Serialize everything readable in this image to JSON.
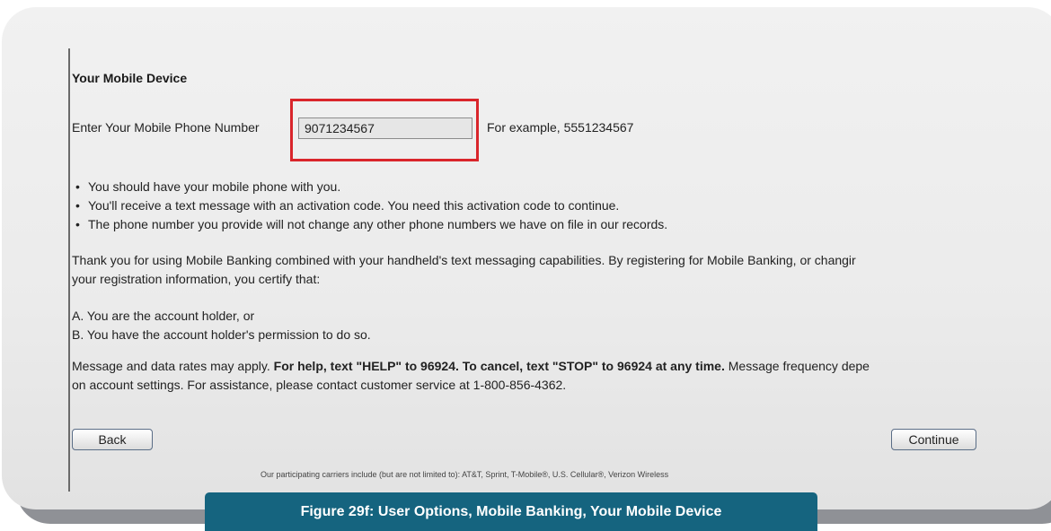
{
  "section_title": "Your Mobile Device",
  "phone": {
    "label": "Enter Your Mobile Phone Number",
    "value": "9071234567",
    "example": "For example, 5551234567"
  },
  "bullets": [
    "You should have your mobile phone with you.",
    "You'll receive a text message with an activation code. You need this activation code to continue.",
    "The phone number you provide will not change any other phone numbers we have on file in our records."
  ],
  "certify": {
    "line1": "Thank you for using Mobile Banking combined with your handheld's text messaging capabilities. By registering for Mobile Banking, or changir",
    "line2": "your registration information, you certify that:"
  },
  "conditions": [
    "A.  You are the account holder, or",
    "B.  You have the account holder's permission to do so."
  ],
  "rates": {
    "prefix": "Message and data rates may apply.",
    "bold": "For help, text \"HELP\" to 96924. To cancel, text \"STOP\" to 96924 at any time.",
    "suffix": "Message frequency depe",
    "line2": "on account settings. For assistance, please contact customer service at 1-800-856-4362."
  },
  "buttons": {
    "back": "Back",
    "continue": "Continue"
  },
  "carriers": "Our participating carriers include (but are not limited to): AT&T, Sprint, T-Mobile®, U.S. Cellular®, Verizon Wireless",
  "caption": "Figure 29f: User Options, Mobile Banking, Your Mobile Device",
  "colors": {
    "highlight": "#d9252b",
    "caption_bg": "#15647f"
  }
}
